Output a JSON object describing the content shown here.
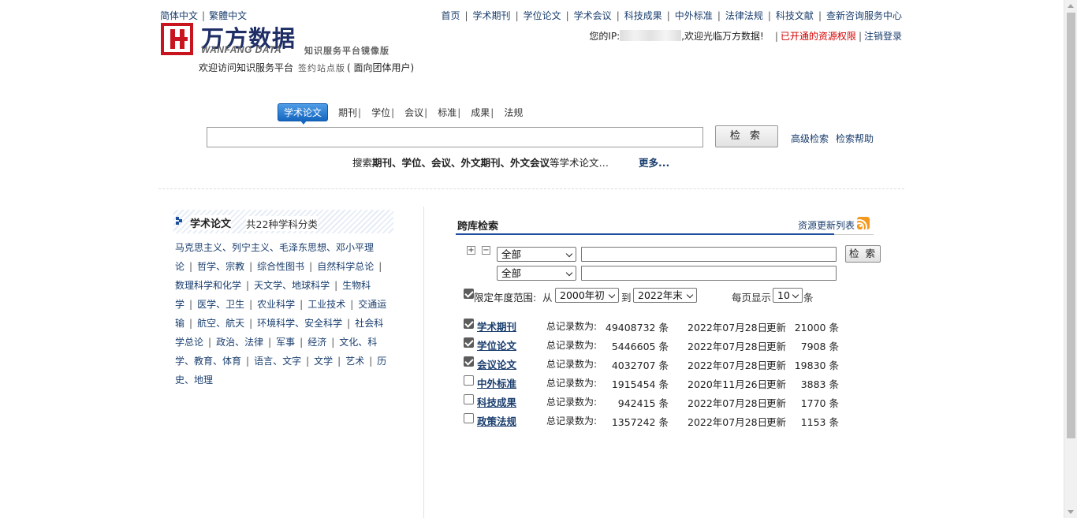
{
  "header": {
    "lang_simplified": "简体中文",
    "lang_traditional": "繁體中文",
    "logo_cn": "万方数据",
    "logo_en": "WANFANG DATA",
    "logo_tagline": "知识服务平台镜像版",
    "welcome_prefix": "欢迎访问知识服务平台",
    "welcome_edition": "签约站点版",
    "welcome_suffix": "( 面向团体用户)",
    "nav": [
      "首页",
      "学术期刊",
      "学位论文",
      "学术会议",
      "科技成果",
      "中外标准",
      "法律法规",
      "科技文献",
      "查新咨询服务中心"
    ],
    "ip_prefix": "您的IP:",
    "ip_suffix": ",欢迎光临万方数据!",
    "resource_rights": "已开通的资源权限",
    "logout": "注销登录"
  },
  "search": {
    "tabs": [
      "学术论文",
      "期刊",
      "学位",
      "会议",
      "标准",
      "成果",
      "法规"
    ],
    "active_tab": "学术论文",
    "query": "",
    "button": "检 索",
    "advanced": "高级检索",
    "help": "检索帮助",
    "hint_prefix": "搜索",
    "hint_bold": "期刊、学位、会议、外文期刊、外文会议",
    "hint_suffix": "等学术论文…",
    "more": "更多..."
  },
  "subjects": {
    "title": "学术论文",
    "subtitle": "共22种学科分类",
    "items": [
      "马克思主义、列宁主义、毛泽东思想、邓小平理论",
      "哲学、宗教",
      "综合性图书",
      "自然科学总论",
      "数理科学和化学",
      "天文学、地球科学",
      "生物科学",
      "医学、卫生",
      "农业科学",
      "工业技术",
      "交通运输",
      "航空、航天",
      "环境科学、安全科学",
      "社会科学总论",
      "政治、法律",
      "军事",
      "经济",
      "文化、科学、教育、体育",
      "语言、文字",
      "文学",
      "艺术",
      "历史、地理"
    ]
  },
  "cross_search": {
    "title": "跨库检索",
    "update_list": "资源更新列表",
    "field1": "全部",
    "field2": "全部",
    "button": "检 索",
    "year_limit_label": "限定年度范围:",
    "year_limit_checked": true,
    "from_label": "从",
    "year_from": "2000年初",
    "to_label": "到",
    "year_to": "2022年末",
    "per_page_label": "每页显示",
    "per_page": "10",
    "per_page_unit": "条",
    "total_label": "总记录数为:",
    "count_unit": "条",
    "update_label": "更新",
    "databases": [
      {
        "name": "学术期刊",
        "checked": true,
        "total": "49408732",
        "date": "2022年07月28日",
        "updated": "21000"
      },
      {
        "name": "学位论文",
        "checked": true,
        "total": "5446605",
        "date": "2022年07月28日",
        "updated": "7908"
      },
      {
        "name": "会议论文",
        "checked": true,
        "total": "4032707",
        "date": "2022年07月28日",
        "updated": "19830"
      },
      {
        "name": "中外标准",
        "checked": false,
        "total": "1915454",
        "date": "2020年11月26日",
        "updated": "3883"
      },
      {
        "name": "科技成果",
        "checked": false,
        "total": "942415",
        "date": "2022年07月28日",
        "updated": "1770"
      },
      {
        "name": "政策法规",
        "checked": false,
        "total": "1357242",
        "date": "2022年07月28日",
        "updated": "1153"
      }
    ]
  }
}
